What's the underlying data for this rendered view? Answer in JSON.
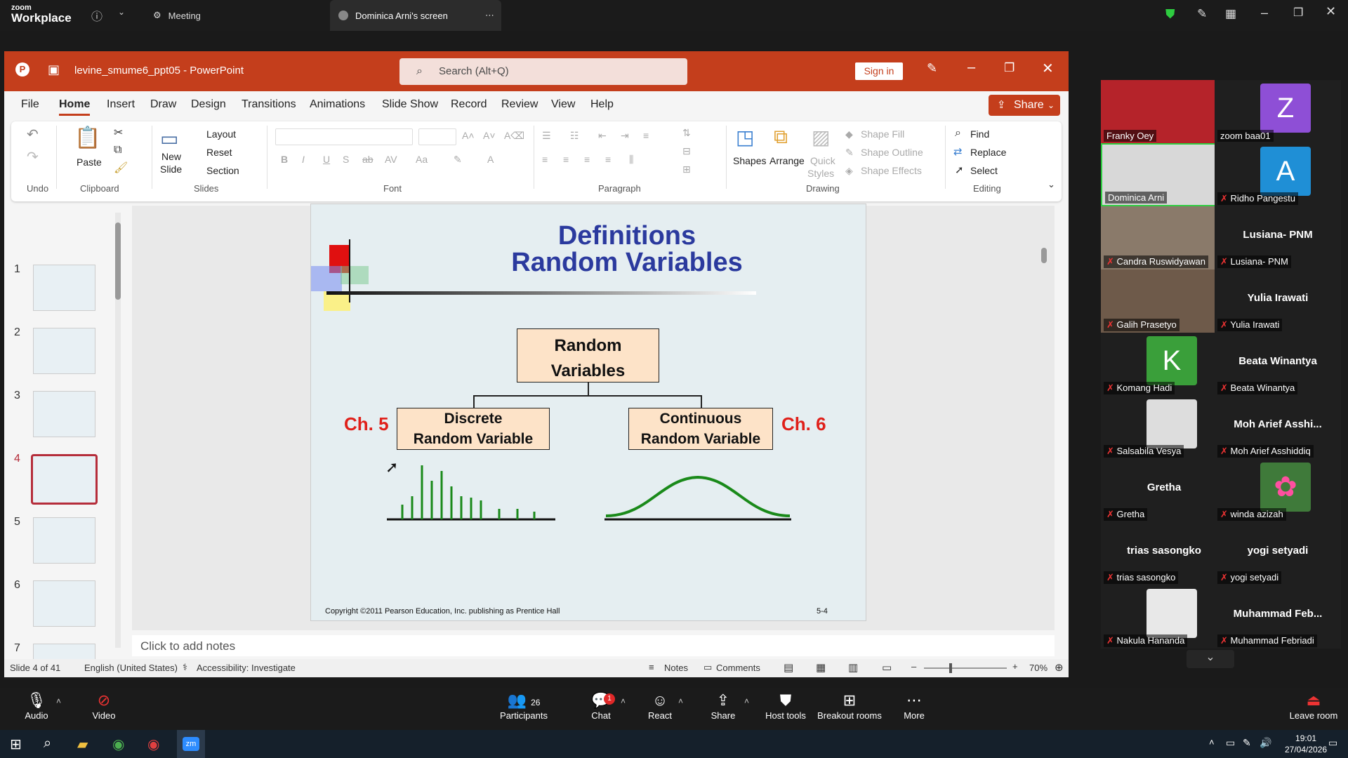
{
  "zoom": {
    "brand_top": "zoom",
    "brand_bottom": "Workplace",
    "tab_meeting": "Meeting",
    "tab_screen": "Dominica Arni's screen",
    "bottom": {
      "audio": "Audio",
      "video": "Video",
      "participants": "Participants",
      "participants_count": "26",
      "chat": "Chat",
      "chat_badge": "1",
      "react": "React",
      "share": "Share",
      "host_tools": "Host tools",
      "breakout": "Breakout rooms",
      "more": "More",
      "leave": "Leave room"
    }
  },
  "ppt": {
    "filename": "levine_smume6_ppt05",
    "app": "PowerPoint",
    "search_placeholder": "Search (Alt+Q)",
    "sign_in": "Sign in",
    "tabs": [
      "File",
      "Home",
      "Insert",
      "Draw",
      "Design",
      "Transitions",
      "Animations",
      "Slide Show",
      "Record",
      "Review",
      "View",
      "Help"
    ],
    "share": "Share",
    "ribbon": {
      "undo_group": "Undo",
      "paste": "Paste",
      "clipboard_group": "Clipboard",
      "new_slide": "New",
      "new_slide2": "Slide",
      "layout": "Layout",
      "reset": "Reset",
      "section": "Section",
      "slides_group": "Slides",
      "font_group": "Font",
      "paragraph_group": "Paragraph",
      "shapes": "Shapes",
      "arrange": "Arrange",
      "quick_styles": "Quick",
      "quick_styles2": "Styles",
      "shape_fill": "Shape Fill",
      "shape_outline": "Shape Outline",
      "shape_effects": "Shape Effects",
      "drawing_group": "Drawing",
      "find": "Find",
      "replace": "Replace",
      "select": "Select",
      "editing_group": "Editing"
    },
    "slide_numbers": [
      "1",
      "2",
      "3",
      "4",
      "5",
      "6",
      "7"
    ],
    "slide": {
      "title1": "Definitions",
      "title2": "Random Variables",
      "root_box1": "Random",
      "root_box2": "Variables",
      "left_box1": "Discrete",
      "left_box2": "Random Variable",
      "right_box1": "Continuous",
      "right_box2": "Random Variable",
      "ch5": "Ch. 5",
      "ch6": "Ch. 6",
      "copyright": "Copyright ©2011 Pearson Education, Inc. publishing as Prentice Hall",
      "page": "5-4"
    },
    "notes_placeholder": "Click to add notes",
    "status": {
      "slide_of": "Slide 4 of 41",
      "language": "English (United States)",
      "accessibility": "Accessibility: Investigate",
      "notes": "Notes",
      "comments": "Comments",
      "zoom": "70%"
    }
  },
  "participants": [
    {
      "name": "Franky Oey",
      "kind": "video"
    },
    {
      "name": "zoom baa01",
      "kind": "avatar",
      "letter": "Z",
      "color": "#8e4fd6"
    },
    {
      "name": "Dominica Arni",
      "kind": "video"
    },
    {
      "name": "Ridho Pangestu",
      "kind": "avatar",
      "letter": "A",
      "color": "#1f8fd6"
    },
    {
      "name": "Candra Ruswidyawan",
      "kind": "video"
    },
    {
      "name": "Lusiana- PNM",
      "kind": "name"
    },
    {
      "name": "Galih Prasetyo",
      "kind": "video"
    },
    {
      "name": "Yulia Irawati",
      "kind": "name"
    },
    {
      "name": "Komang Hadi",
      "kind": "avatar",
      "letter": "K",
      "color": "#3a9f3a"
    },
    {
      "name": "Beata Winantya",
      "kind": "name"
    },
    {
      "name": "Salsabila Vesya",
      "kind": "video"
    },
    {
      "name": "Moh Arief Asshi...",
      "label": "Moh Arief Asshiddiq",
      "kind": "name"
    },
    {
      "name": "Gretha",
      "kind": "name"
    },
    {
      "name": "winda azizah",
      "kind": "photo"
    },
    {
      "name": "trias sasongko",
      "kind": "name"
    },
    {
      "name": "yogi setyadi",
      "kind": "name"
    },
    {
      "name": "Nakula Hananda",
      "kind": "video"
    },
    {
      "name": "Muhammad Feb...",
      "label": "Muhammad Febriadi",
      "kind": "name"
    }
  ],
  "taskbar": {
    "time": "19:01",
    "date": "27/04/2026"
  },
  "colors": {
    "ppt_accent": "#c43e1c",
    "slide_title": "#2b3a9e",
    "chapter_red": "#e0201a",
    "curve_green": "#1a8a1a",
    "box_fill": "#fde3c8"
  }
}
